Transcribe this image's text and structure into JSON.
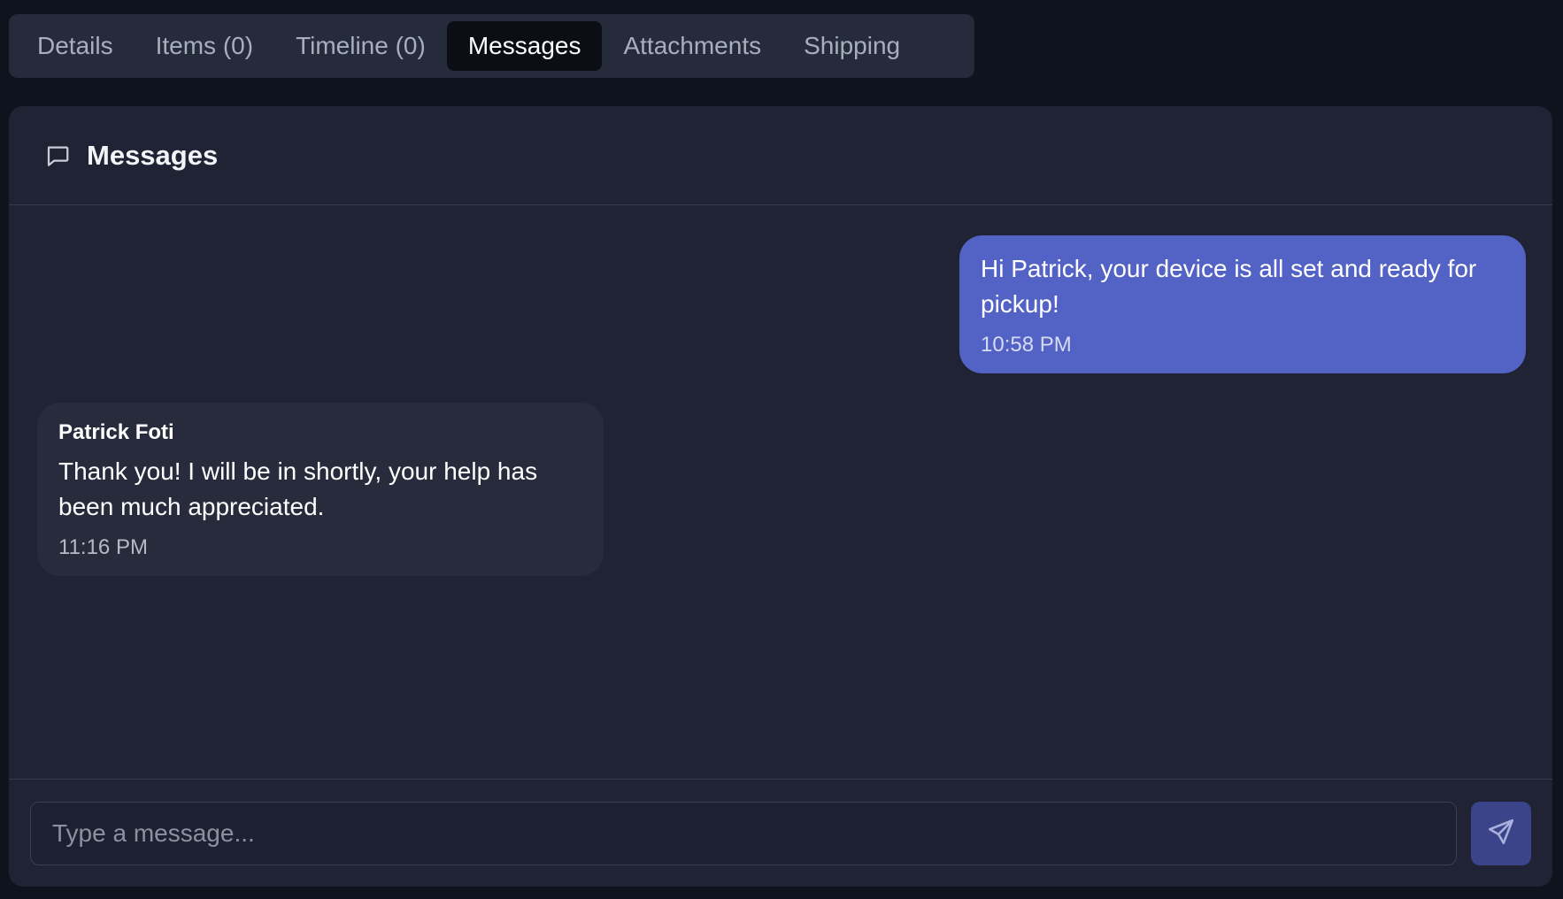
{
  "tabs": [
    {
      "label": "Details"
    },
    {
      "label": "Items (0)"
    },
    {
      "label": "Timeline (0)"
    },
    {
      "label": "Messages",
      "active": true
    },
    {
      "label": "Attachments"
    },
    {
      "label": "Shipping"
    }
  ],
  "panel": {
    "title": "Messages",
    "icon": "chat-bubble-icon"
  },
  "messages": [
    {
      "direction": "outgoing",
      "text": "Hi Patrick, your device is all set and ready for pickup!",
      "time": "10:58 PM"
    },
    {
      "direction": "incoming",
      "sender": "Patrick Foti",
      "text": "Thank you! I will be in shortly, your help has been much appreciated.",
      "time": "11:16 PM"
    }
  ],
  "composer": {
    "placeholder": "Type a message...",
    "value": "",
    "send_icon": "send-icon"
  },
  "colors": {
    "accent": "#5363c5",
    "send_button": "#3b4489",
    "panel_bg": "#1f2333"
  }
}
